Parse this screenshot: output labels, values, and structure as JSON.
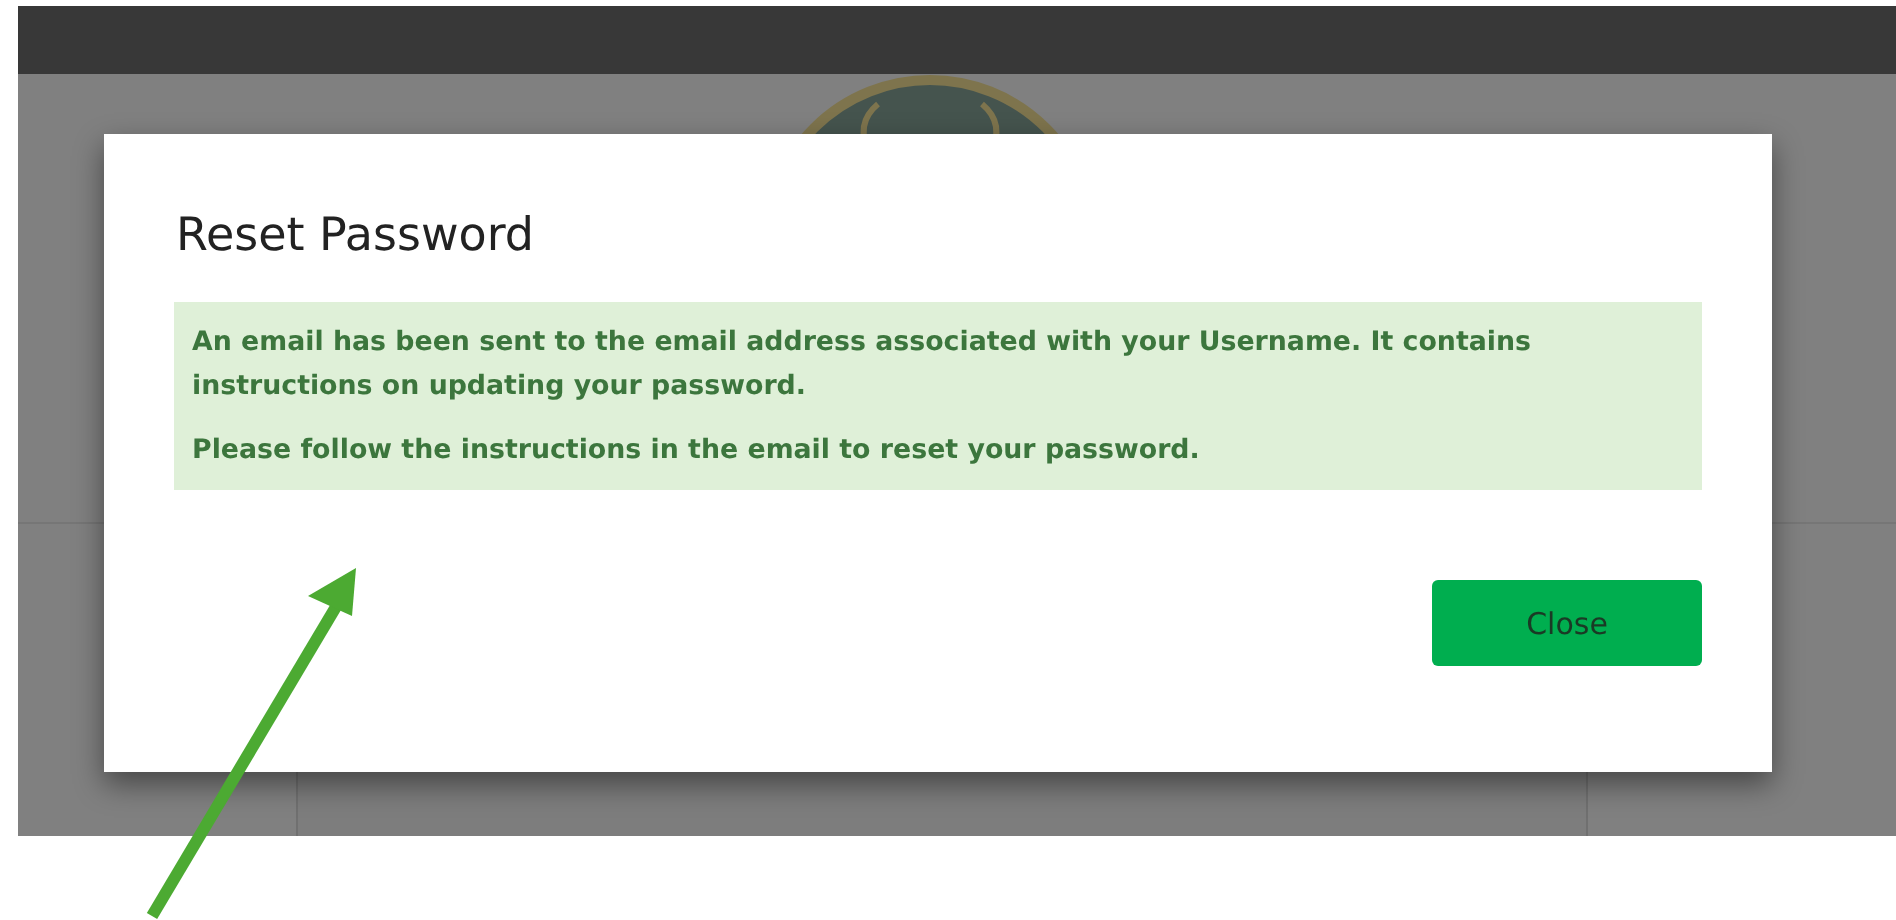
{
  "dialog": {
    "title": "Reset Password",
    "alert": {
      "paragraphs": [
        "An email has been sent to the email address associated with your Username. It contains instructions on updating your password.",
        "Please follow the instructions in the email to reset your password."
      ]
    },
    "buttons": [
      {
        "label": "Close"
      }
    ]
  }
}
